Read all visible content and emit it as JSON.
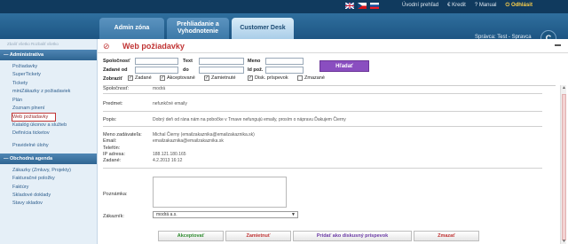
{
  "topbar": {
    "links": [
      "Úvodní prehľad",
      "Kredit",
      "Manual",
      "Odhlásit"
    ],
    "flags": [
      "uk-flag-icon",
      "czech-flag-icon",
      "slovak-flag-icon"
    ]
  },
  "tabs": [
    {
      "label": "Admin zóna"
    },
    {
      "label": "Prehliadanie a Vyhodnotenie"
    },
    {
      "label": "Customer Desk"
    }
  ],
  "user": "Správca: Test - Spravca",
  "sidebar": {
    "back_links": "Zbaliť všetko    Rozbaliť všetko",
    "section1": "Administratíva",
    "items1": [
      "Požiadavky",
      "SuperTickety",
      "Tickety",
      "miniZákazky z požiadaviek",
      "Plán",
      "Zoznam plnení",
      "Web požiadavky",
      "Katalóg úkonov a služieb",
      "Definícia ticketov"
    ],
    "item_extra": "Pravidelné úlohy",
    "section2": "Obchodná agenda",
    "items2": [
      "Zákazky (Zmluvy, Projekty)",
      "Fakturačné položky",
      "Faktúry",
      "Skladové doklady",
      "Stavy skladov"
    ]
  },
  "page": {
    "title": "Web požiadavky"
  },
  "filter": {
    "company": "Spoločnosť",
    "text": "Text",
    "name": "Meno",
    "from": "Zadané od",
    "to": "do",
    "idreq": "Id pož.",
    "search_btn": "Hľadať",
    "show": "Zobraziť",
    "checks": [
      {
        "label": "Zadané",
        "checked": true
      },
      {
        "label": "Akceptované",
        "checked": true
      },
      {
        "label": "Zamietnuté",
        "checked": true
      },
      {
        "label": "Disk. príspevok",
        "checked": true
      },
      {
        "label": "Zmazané",
        "checked": false
      }
    ]
  },
  "detail": {
    "company_label": "Spoločnosť:",
    "company_value": "modrá",
    "subject_label": "Predmet:",
    "subject_value": "nefunkčné emaily",
    "desc_label": "Popis:",
    "desc_value": "Dobrý deň od rána nám na pobočke v Trnave nefungujú emaily, prosím o nápravu Ďakujem Čierny",
    "name_label": "Meno zadávateľa:",
    "name_value": "Michal Čierny (emailzakaznika@emailzakaznika.sk)",
    "email_label": "Email:",
    "email_value": "emailzakaznika@emailzakaznika.sk",
    "phone_label": "Telefón:",
    "ip_label": "IP adresa:",
    "ip_value": "188.121.180.165",
    "date_label": "Zadané:",
    "date_value": "4.2.2013 16:12",
    "note_label": "Poznámka:",
    "customer_label": "Zákazník:",
    "customer_value": "modrá a.s."
  },
  "actions": {
    "accept": "Akceptovať",
    "reject": "Zamietnuť",
    "discuss": "Pridať ako diskusný príspevok",
    "delete": "Zmazať"
  },
  "colors": {
    "accent": "#c03434",
    "accept": "#2e8b2e",
    "purple": "#8a4ec0"
  }
}
